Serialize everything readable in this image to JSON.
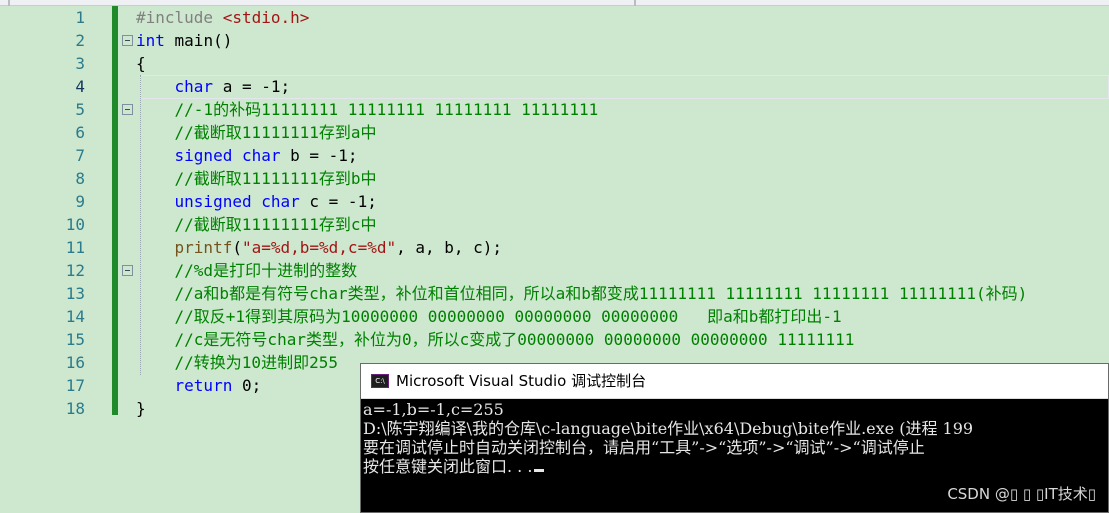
{
  "editor": {
    "line_numbers": [
      "1",
      "2",
      "3",
      "4",
      "5",
      "6",
      "7",
      "8",
      "9",
      "10",
      "11",
      "12",
      "13",
      "14",
      "15",
      "16",
      "17",
      "18"
    ],
    "lines": {
      "l1": {
        "pp": "#include ",
        "str": "<stdio.h>"
      },
      "l2": {
        "kw": "int",
        "rest": " main()"
      },
      "l3": {
        "text": "{"
      },
      "l4": {
        "indent": "    ",
        "kw": "char",
        "rest": " a = -1;"
      },
      "l5": {
        "indent": "    ",
        "comment": "//-1的补码11111111 11111111 11111111 11111111"
      },
      "l6": {
        "indent": "    ",
        "comment": "//截断取11111111存到a中"
      },
      "l7": {
        "indent": "    ",
        "kw1": "signed",
        "sp": " ",
        "kw2": "char",
        "rest": " b = -1;"
      },
      "l8": {
        "indent": "    ",
        "comment": "//截断取11111111存到b中"
      },
      "l9": {
        "indent": "    ",
        "kw1": "unsigned",
        "sp": " ",
        "kw2": "char",
        "rest": " c = -1;"
      },
      "l10": {
        "indent": "    ",
        "comment": "//截断取11111111存到c中"
      },
      "l11": {
        "indent": "    ",
        "fn": "printf",
        "p1": "(",
        "str": "\"a=%d,b=%d,c=%d\"",
        "rest": ", a, b, c);"
      },
      "l12": {
        "indent": "    ",
        "comment": "//%d是打印十进制的整数"
      },
      "l13": {
        "indent": "    ",
        "comment": "//a和b都是有符号char类型，补位和首位相同，所以a和b都变成11111111 11111111 11111111 11111111(补码)"
      },
      "l14": {
        "indent": "    ",
        "comment": "//取反+1得到其原码为10000000 00000000 00000000 00000000   即a和b都打印出-1"
      },
      "l15": {
        "indent": "    ",
        "comment": "//c是无符号char类型，补位为0，所以c变成了00000000 00000000 00000000 11111111"
      },
      "l16": {
        "indent": "    ",
        "comment": "//转换为10进制即255"
      },
      "l17": {
        "indent": "    ",
        "kw": "return",
        "rest": " 0;"
      },
      "l18": {
        "text": "}"
      }
    }
  },
  "console": {
    "icon_text": "C:\\",
    "title": "Microsoft Visual Studio 调试控制台",
    "lines": [
      "a=-1,b=-1,c=255",
      "D:\\陈宇翔编译\\我的仓库\\c-language\\bite作业\\x64\\Debug\\bite作业.exe (进程 199",
      "要在调试停止时自动关闭控制台，请启用“工具”->“选项”->“调试”->“调试停止",
      "按任意键关闭此窗口. . ."
    ],
    "watermark": "CSDN @▯ ▯ ▯IT技术▯"
  },
  "colors": {
    "editor_bg": "#cde8cf",
    "keyword": "#0000ff",
    "comment": "#008000",
    "string": "#a31515",
    "line_number": "#2b7b8c",
    "change_bar": "#1e8a2a",
    "console_bg": "#000000"
  }
}
